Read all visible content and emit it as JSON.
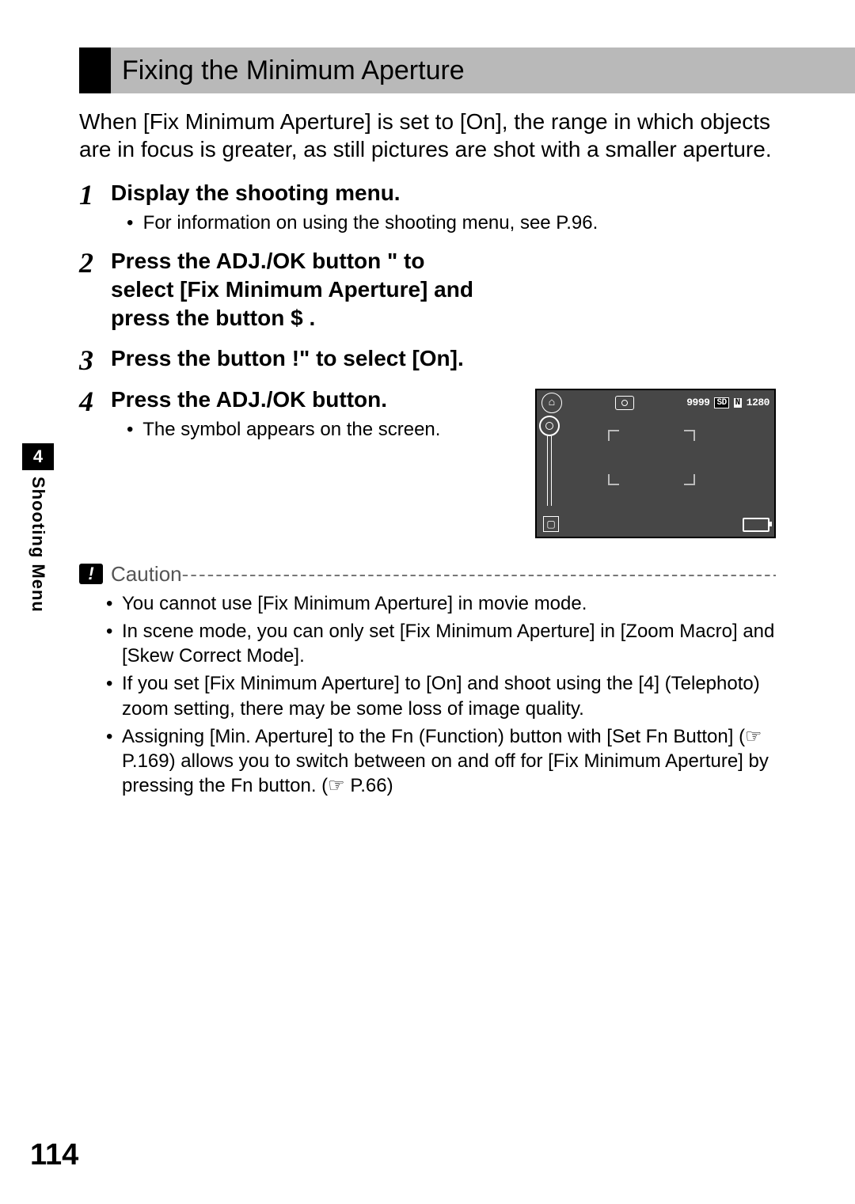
{
  "title": "Fixing the Minimum Aperture",
  "intro": "When [Fix Minimum Aperture] is set to [On], the range in which objects are in focus is greater, as still pictures are shot with a smaller aperture.",
  "steps": [
    {
      "num": "1",
      "title": "Display the shooting menu.",
      "sub": "For information on using the shooting menu, see P.96."
    },
    {
      "num": "2",
      "title": "Press the ADJ./OK button \"   to select [Fix Minimum Aperture] and press the button $ .",
      "sub": ""
    },
    {
      "num": "3",
      "title": "Press the button !\"     to select [On].",
      "sub": ""
    },
    {
      "num": "4",
      "title": "Press the ADJ./OK button.",
      "sub": "The symbol appears on the screen."
    }
  ],
  "camera": {
    "shots_remaining": "9999",
    "sd_badge": "SD",
    "n_badge": "N",
    "resolution": "1280"
  },
  "caution": {
    "label": "Caution",
    "dashes": "--------------------------------------------------------------------------------------",
    "items": [
      "You cannot use [Fix Minimum Aperture] in movie mode.",
      "In scene mode, you can only set [Fix Minimum Aperture] in [Zoom Macro] and [Skew Correct Mode].",
      "If you set [Fix Minimum Aperture] to [On] and shoot using the [4] (Telephoto) zoom setting, there may be some loss of image quality.",
      "Assigning [Min. Aperture] to the Fn (Function) button with [Set Fn Button] (☞ P.169) allows you to switch between on and off for [Fix Minimum Aperture] by pressing the Fn button. (☞ P.66)"
    ]
  },
  "side": {
    "chapter": "4",
    "label": "Shooting Menu"
  },
  "page_number": "114"
}
